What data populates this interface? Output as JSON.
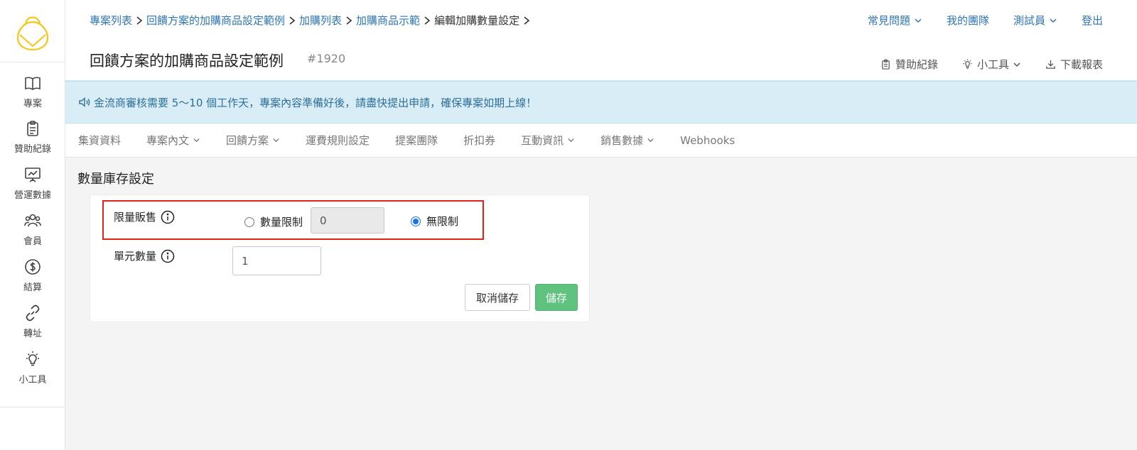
{
  "sidebar": {
    "items": [
      {
        "label": "專案",
        "icon": "book-icon"
      },
      {
        "label": "贊助紀錄",
        "icon": "clipboard-icon"
      },
      {
        "label": "營運數據",
        "icon": "chart-board-icon"
      },
      {
        "label": "會員",
        "icon": "users-icon"
      },
      {
        "label": "結算",
        "icon": "dollar-icon"
      },
      {
        "label": "轉址",
        "icon": "link-icon"
      },
      {
        "label": "小工具",
        "icon": "lightbulb-icon"
      }
    ]
  },
  "header": {
    "breadcrumb": [
      "專案列表",
      "回饋方案的加購商品設定範例",
      "加購列表",
      "加購商品示範",
      "編輯加購數量設定"
    ],
    "title": "回饋方案的加購商品設定範例",
    "project_id": "#1920",
    "top_links": {
      "faq": "常見問題",
      "team": "我的團隊",
      "user": "測試員",
      "logout": "登出"
    },
    "tools": {
      "sponsor_log": "贊助紀錄",
      "gadget": "小工具",
      "download": "下載報表"
    }
  },
  "banner": {
    "text": "金流商審核需要 5～10 個工作天，專案內容準備好後，請盡快提出申請，確保專案如期上線！"
  },
  "tabs": [
    {
      "label": "集資資料",
      "dropdown": false
    },
    {
      "label": "專案內文",
      "dropdown": true
    },
    {
      "label": "回饋方案",
      "dropdown": true
    },
    {
      "label": "運費規則設定",
      "dropdown": false
    },
    {
      "label": "提案團隊",
      "dropdown": false
    },
    {
      "label": "折扣券",
      "dropdown": false
    },
    {
      "label": "互動資訊",
      "dropdown": true
    },
    {
      "label": "銷售數據",
      "dropdown": true
    },
    {
      "label": "Webhooks",
      "dropdown": false
    }
  ],
  "form": {
    "section_title": "數量庫存設定",
    "limit_label": "限量販售",
    "qty_limit_option": "數量限制",
    "qty_limit_value": "0",
    "unlimited_option": "無限制",
    "unit_label": "單元數量",
    "unit_value": "1",
    "cancel_label": "取消儲存",
    "save_label": "儲存"
  },
  "colors": {
    "link": "#2f76b5",
    "banner_bg": "#d9edf6",
    "save": "#5fc27e",
    "highlight": "#e0221b",
    "logo": "#f5c518"
  }
}
